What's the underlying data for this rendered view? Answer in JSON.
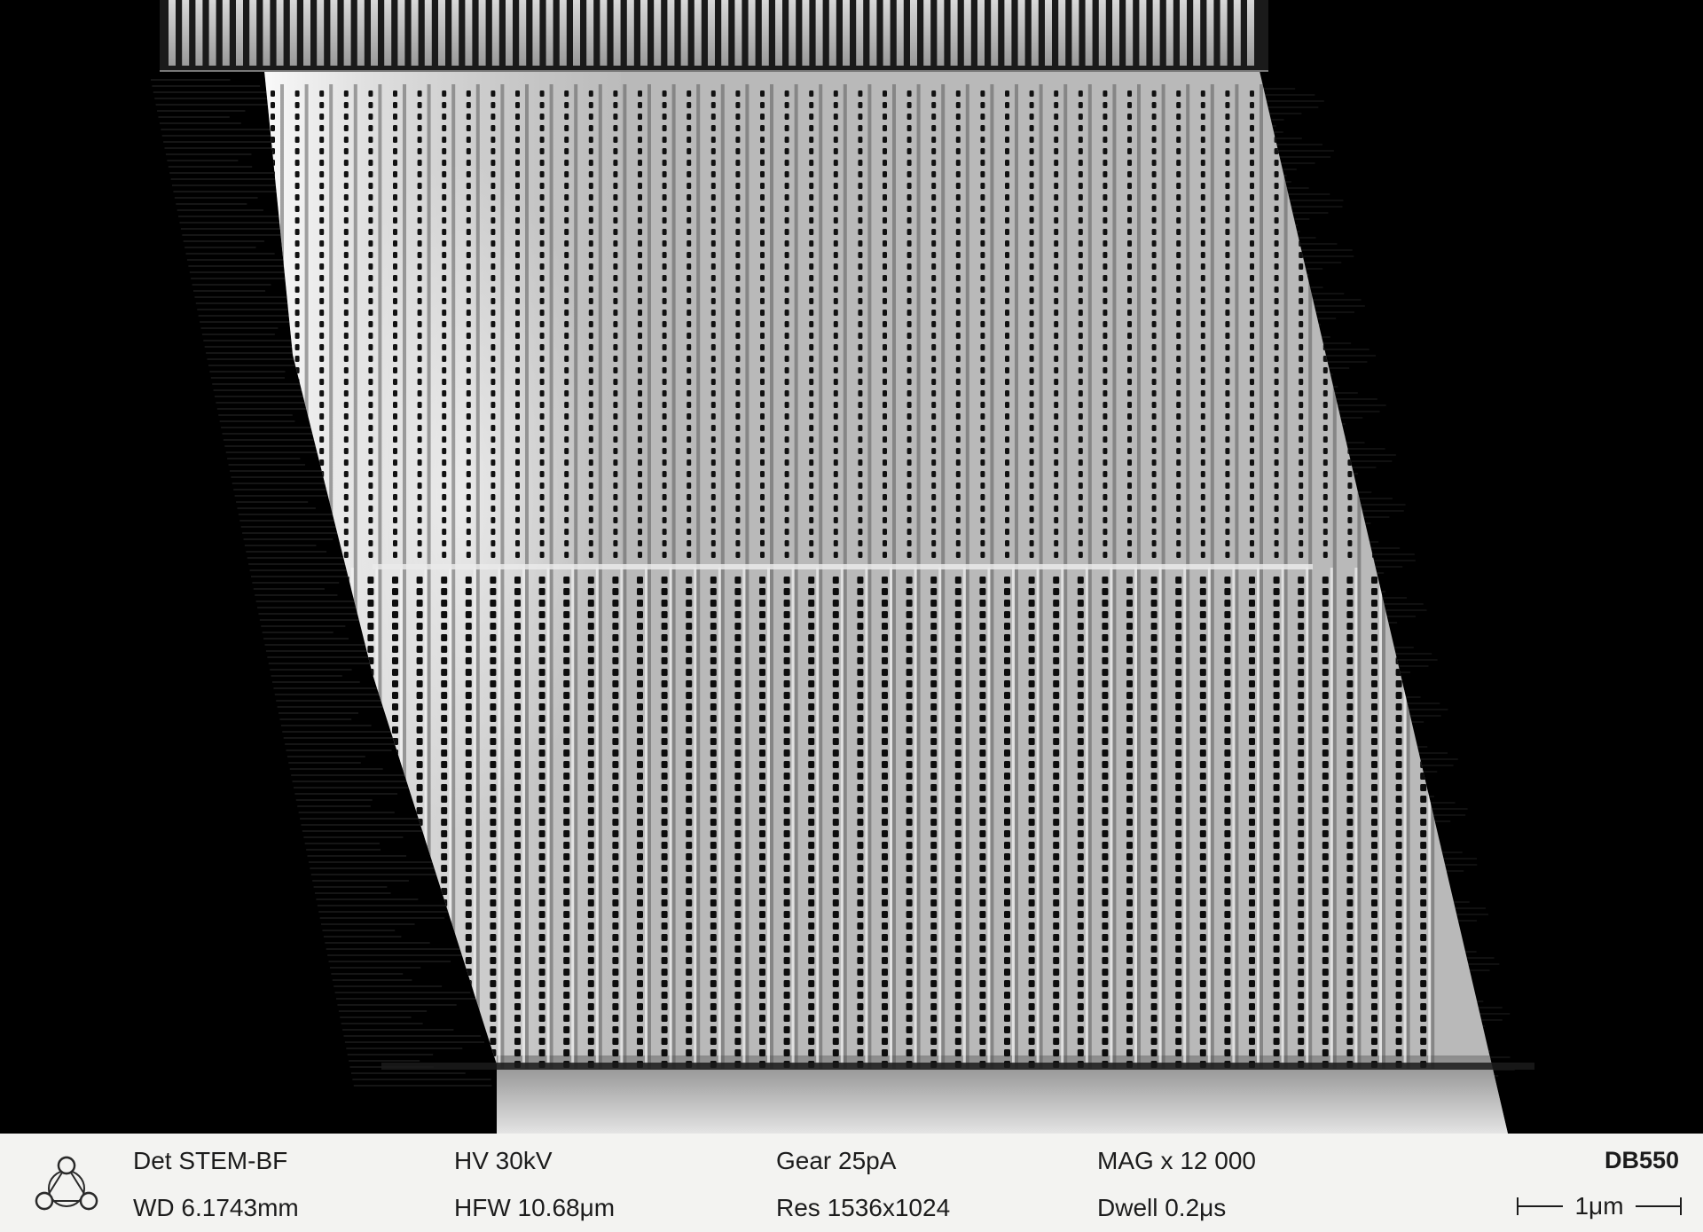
{
  "image": {
    "description_icon": "sem-micrograph",
    "colors": {
      "background": "#000000",
      "databar": "#f3f3f1",
      "text": "#1c1c1c"
    }
  },
  "databar": {
    "logo_icon": "triangle-circles-logo-icon",
    "det": "Det STEM-BF",
    "wd": "WD 6.1743mm",
    "hv": "HV 30kV",
    "hfw": "HFW 10.68μm",
    "gear": "Gear 25pA",
    "res": "Res 1536x1024",
    "mag": "MAG x 12 000",
    "dwell": "Dwell 0.2μs",
    "id": "DB550",
    "scale": "1μm"
  }
}
